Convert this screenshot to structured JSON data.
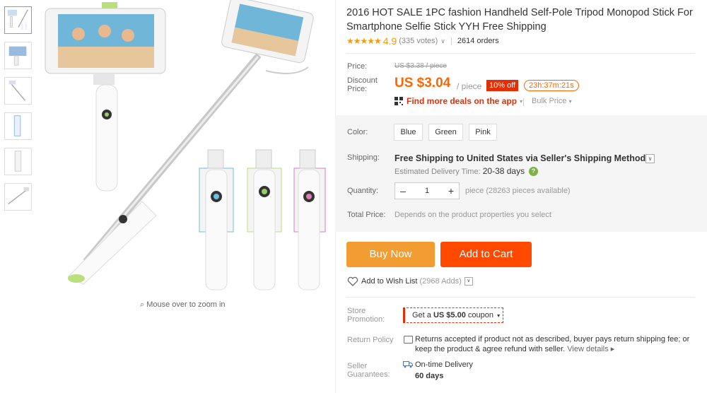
{
  "product": {
    "title": "2016 HOT SALE 1PC fashion Handheld Self-Pole Tripod Monopod Stick For Smartphone Selfie Stick YYH Free Shipping",
    "rating": "4.9",
    "stars": "★★★★★",
    "votes": "(335 votes)",
    "orders": "2614 orders"
  },
  "gallery": {
    "zoom_hint": "Mouse over to zoom in",
    "thumbnails": 6
  },
  "price": {
    "label": "Price:",
    "original": "US $3.38 / piece",
    "discount_label": "Discount Price:",
    "discount": "US $3.04",
    "per_piece": "/ piece",
    "badge": "10% off",
    "countdown": "23h:37m:21s",
    "app_deals": "Find more deals on the app",
    "bulk": "Bulk Price"
  },
  "options": {
    "color_label": "Color:",
    "colors": [
      "Blue",
      "Green",
      "Pink"
    ],
    "shipping_label": "Shipping:",
    "shipping_free": "Free Shipping",
    "shipping_to": "to United States via Seller's Shipping Method",
    "est_label": "Estimated Delivery Time:",
    "est_days": "20-38 days",
    "quantity_label": "Quantity:",
    "quantity": "1",
    "qty_avail": "piece (28263 pieces available)",
    "total_label": "Total Price:",
    "total_text": "Depends on the product properties you select"
  },
  "actions": {
    "buy_now": "Buy Now",
    "add_cart": "Add to Cart",
    "wishlist": "Add to Wish List",
    "wishlist_count": "(2968 Adds)"
  },
  "store": {
    "promo_label": "Store Promotion:",
    "coupon_prefix": "Get a",
    "coupon_amount": "US $5.00",
    "coupon_suffix": "coupon",
    "return_label": "Return Policy",
    "return_text": "Returns accepted if product not as described, buyer pays return shipping fee; or keep the product & agree refund with seller.",
    "view_details": "View details",
    "guarantee_label": "Seller Guarantees:",
    "ontime": "On-time Delivery",
    "days": "60 days"
  },
  "colors": {
    "accent": "#ff4a00",
    "buy": "#f39c32",
    "red": "#e62e04",
    "orange": "#ff6600"
  }
}
